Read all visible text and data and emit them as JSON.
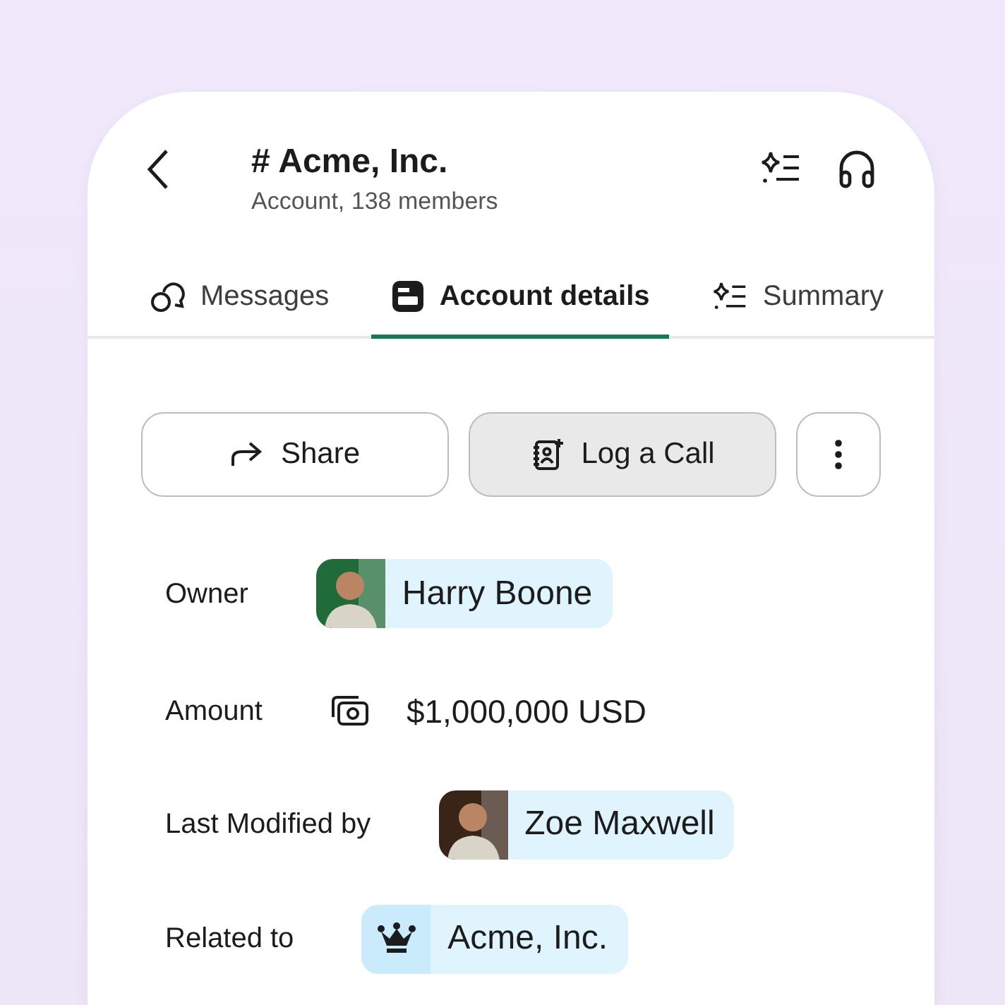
{
  "header": {
    "title": "# Acme, Inc.",
    "subtitle": "Account, 138 members"
  },
  "tabs": [
    {
      "label": "Messages",
      "kind": "messages",
      "selected": false
    },
    {
      "label": "Account details",
      "kind": "details",
      "selected": true
    },
    {
      "label": "Summary",
      "kind": "summary",
      "selected": false
    }
  ],
  "actions": [
    {
      "label": "Share",
      "kind": "share",
      "selected": false
    },
    {
      "label": "Log a Call",
      "kind": "log",
      "selected": true
    }
  ],
  "fields": [
    {
      "label": "Owner",
      "kind": "person",
      "value": "Harry Boone",
      "color": "#1f6b3a"
    },
    {
      "label": "Amount",
      "kind": "money",
      "value": "$1,000,000 USD"
    },
    {
      "label": "Last Modified by",
      "kind": "person",
      "value": "Zoe Maxwell",
      "color": "#3a2418"
    },
    {
      "label": "Related to",
      "kind": "record",
      "value": "Acme, Inc."
    }
  ]
}
